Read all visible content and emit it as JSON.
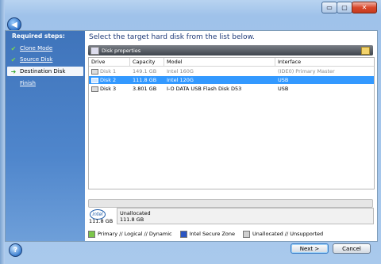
{
  "window": {
    "min_glyph": "▭",
    "max_glyph": "▢",
    "close_glyph": "✕"
  },
  "nav": {
    "back_glyph": "◀"
  },
  "sidebar": {
    "title": "Required steps:",
    "items": [
      {
        "label": "Clone Mode",
        "icon": "check-icon",
        "glyph": "✔",
        "state": "done"
      },
      {
        "label": "Source Disk",
        "icon": "check-icon",
        "glyph": "✔",
        "state": "done"
      },
      {
        "label": "Destination Disk",
        "icon": "arrow-right-icon",
        "glyph": "➜",
        "state": "active"
      },
      {
        "label": "Finish",
        "icon": "",
        "glyph": "",
        "state": "pending"
      }
    ]
  },
  "main": {
    "heading": "Select the target hard disk from the list below.",
    "toolbar": {
      "disk_properties": "Disk properties"
    },
    "table": {
      "columns": [
        "Drive",
        "Capacity",
        "Model",
        "Interface"
      ],
      "rows": [
        {
          "drive": "Disk 1",
          "capacity": "149.1 GB",
          "model": "Intel 160G",
          "interface": "(IDE0) Primary Master",
          "state": "disabled"
        },
        {
          "drive": "Disk 2",
          "capacity": "111.8 GB",
          "model": "Intel 120G",
          "interface": "USB",
          "state": "selected"
        },
        {
          "drive": "Disk 3",
          "capacity": "3.801 GB",
          "model": "I-O DATA USB Flash Disk D53",
          "interface": "USB",
          "state": "normal"
        }
      ]
    },
    "disk_map": {
      "brand": "intel",
      "size": "111.8 GB",
      "partition_label": "Unallocated",
      "partition_size": "111.8 GB"
    },
    "legend": [
      {
        "label": "Primary // Logical // Dynamic",
        "color": "#7cc64a"
      },
      {
        "label": "Intel Secure Zone",
        "color": "#2a55c2"
      },
      {
        "label": "Unallocated // Unsupported",
        "color": "#cfcfcf"
      }
    ]
  },
  "footer": {
    "help_glyph": "?",
    "next_label": "Next >",
    "cancel_label": "Cancel"
  }
}
